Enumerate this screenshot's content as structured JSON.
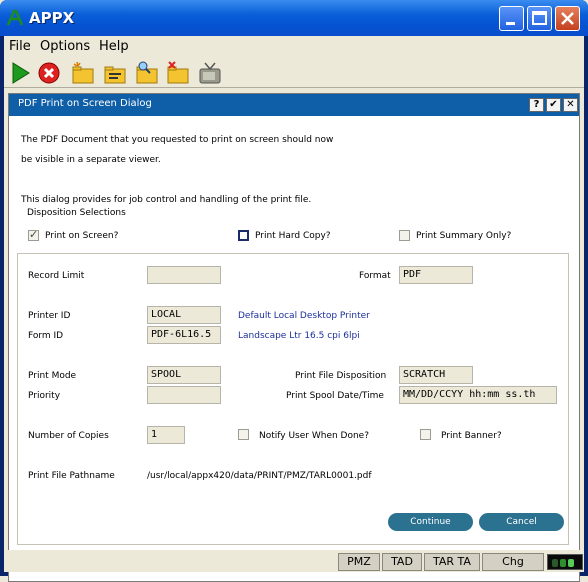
{
  "window": {
    "title": "APPX"
  },
  "menu": [
    "File",
    "Options",
    "Help"
  ],
  "toolbar": [
    "run-icon",
    "stop-icon",
    "new-folder-icon",
    "folder-edit-icon",
    "folder-search-icon",
    "folder-delete-icon",
    "tv-icon"
  ],
  "dialog": {
    "title": "PDF Print on Screen Dialog",
    "buttons": {
      "help": "?",
      "ok": "✔",
      "close": "✕"
    },
    "message1": "The PDF Document that you requested to print on screen should now",
    "message2": "be visible in a separate viewer.",
    "message3": "This dialog provides for job control and handling of the print file.",
    "group_label": "Disposition Selections",
    "print_on_screen": "Print on Screen?",
    "print_hard_copy": "Print Hard Copy?",
    "print_summary_only": "Print Summary Only?",
    "record_limit_label": "Record Limit",
    "record_limit_value": "",
    "format_label": "Format",
    "format_value": "PDF",
    "printer_id_label": "Printer ID",
    "printer_id_value": "LOCAL",
    "printer_id_desc": "Default Local Desktop Printer",
    "form_id_label": "Form ID",
    "form_id_value": "PDF-6L16.5",
    "form_id_desc": "Landscape Ltr 16.5 cpi 6lpi",
    "print_mode_label": "Print Mode",
    "print_mode_value": "SPOOL",
    "priority_label": "Priority",
    "priority_value": "",
    "file_disposition_label": "Print File Disposition",
    "file_disposition_value": "SCRATCH",
    "spool_date_label": "Print Spool Date/Time",
    "spool_date_value": "MM/DD/CCYY hh:mm ss.th",
    "copies_label": "Number of Copies",
    "copies_value": "1",
    "notify_label": "Notify User When Done?",
    "banner_label": "Print Banner?",
    "pathname_label": "Print File Pathname",
    "pathname_value": "/usr/local/appx420/data/PRINT/PMZ/TARL0001.pdf",
    "continue_label": "Continue",
    "cancel_label": "Cancel"
  },
  "statusbar": {
    "p1": "PMZ",
    "p2": "TAD",
    "p3": "TAR TA",
    "p4": "Chg"
  },
  "colors": {
    "titlebar": "#0a5fd8",
    "dialog_title": "#0f5ea8",
    "button": "#2b7190",
    "link_text": "#1c2f9a"
  }
}
